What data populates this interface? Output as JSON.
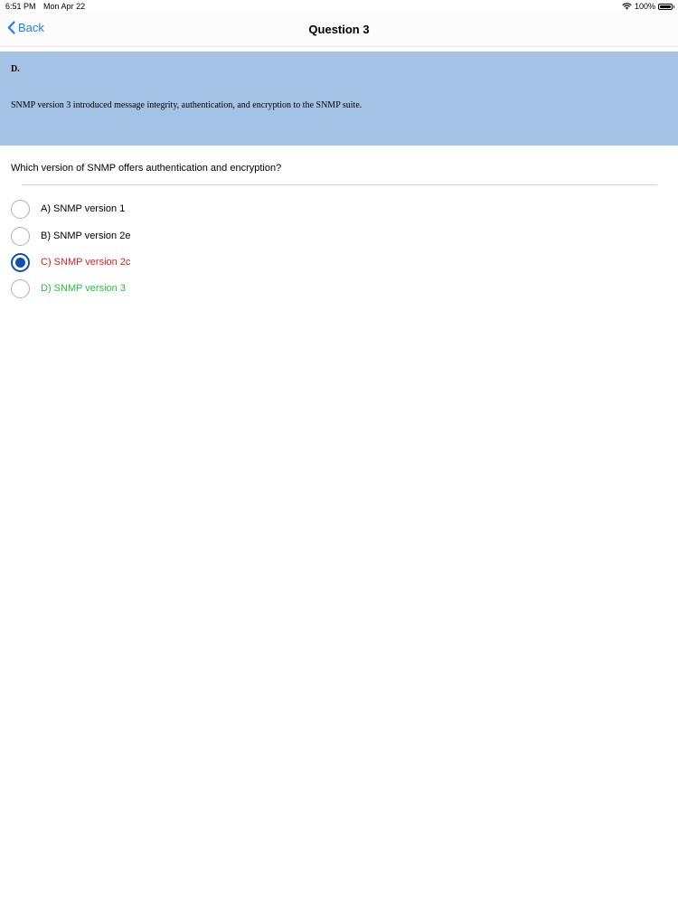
{
  "status": {
    "time": "6:51 PM",
    "date": "Mon Apr 22",
    "battery": "100%",
    "wifi_icon": "wifi-icon",
    "battery_level": 1.0
  },
  "nav": {
    "back_label": "Back",
    "title": "Question 3"
  },
  "answer": {
    "letter": "D.",
    "explanation": "SNMP version 3 introduced message integrity, authentication, and encryption to the SNMP suite.",
    "background_color": "#a4c2e6"
  },
  "question": {
    "text": "Which version of SNMP offers authentication and encryption?",
    "options": [
      {
        "label": "A) SNMP version 1",
        "state": "normal"
      },
      {
        "label": "B) SNMP version 2e",
        "state": "normal"
      },
      {
        "label": "C) SNMP version 2c",
        "state": "selected-wrong",
        "color": "#e02020"
      },
      {
        "label": "D) SNMP version 3",
        "state": "correct",
        "color": "#29c03f"
      }
    ]
  },
  "colors": {
    "accent": "#1a7ff5",
    "radio_selected": "#0f4fb0"
  }
}
